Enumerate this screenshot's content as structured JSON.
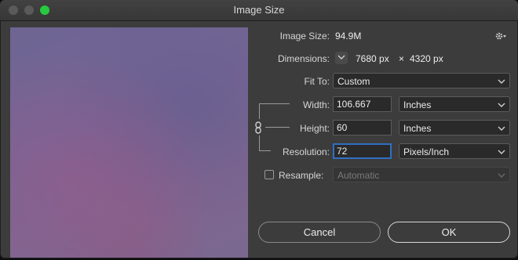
{
  "window": {
    "title": "Image Size"
  },
  "image_size": {
    "label": "Image Size:",
    "value": "94.9M"
  },
  "dimensions": {
    "label": "Dimensions:",
    "width": "7680 px",
    "times": "×",
    "height": "4320 px"
  },
  "fit_to": {
    "label": "Fit To:",
    "value": "Custom"
  },
  "width": {
    "label": "Width:",
    "value": "106.667",
    "unit": "Inches"
  },
  "height": {
    "label": "Height:",
    "value": "60",
    "unit": "Inches"
  },
  "resolution": {
    "label": "Resolution:",
    "value": "72",
    "unit": "Pixels/Inch"
  },
  "resample": {
    "label": "Resample:",
    "checked": false,
    "value": "Automatic"
  },
  "buttons": {
    "cancel": "Cancel",
    "ok": "OK"
  },
  "colors": {
    "accent": "#2f6fc4",
    "traffic_green": "#28c840",
    "window_bg": "#3c3c3c"
  },
  "icons": [
    "gear-icon",
    "chevron-down-icon",
    "chain-link-icon"
  ]
}
